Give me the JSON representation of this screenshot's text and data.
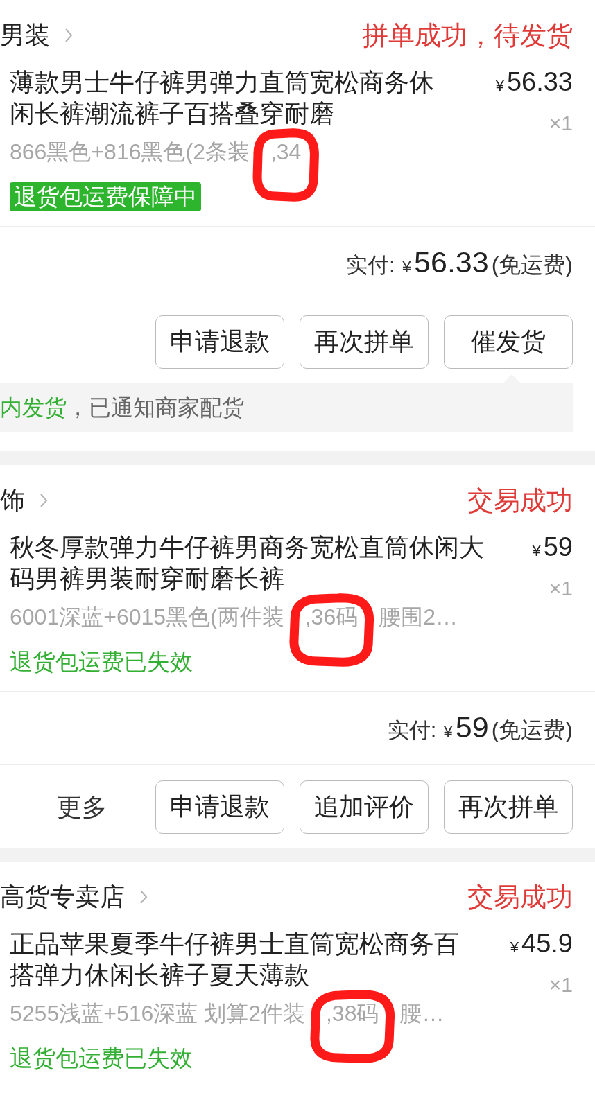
{
  "orders": [
    {
      "shop": "男装",
      "status": "拼单成功，待发货",
      "product": {
        "title": "薄款男士牛仔裤男弹力直筒宽松商务休闲长裤潮流裤子百搭叠穿耐磨",
        "spec": [
          {
            "text": "866黑色+816黑色(2条装",
            "circled": false
          },
          {
            "text": ",34",
            "circled": true
          }
        ],
        "currency": "¥",
        "price": "56.33",
        "quantity": "×1"
      },
      "guarantee": {
        "text": "退货包运费保障中",
        "active": true
      },
      "payment": {
        "label": "实付:",
        "currency": "¥",
        "amount": "56.33",
        "note": "(免运费)"
      },
      "actions": [
        {
          "label": "申请退款",
          "kind": "button"
        },
        {
          "label": "再次拼单",
          "kind": "button"
        },
        {
          "label": "催发货",
          "kind": "button"
        }
      ],
      "tip": {
        "highlight": "内发货",
        "text": "，已通知商家配货"
      }
    },
    {
      "shop": "饰",
      "status": "交易成功",
      "product": {
        "title": "秋冬厚款弹力牛仔裤男商务宽松直筒休闲大码男裤男装耐穿耐磨长裤",
        "spec": [
          {
            "text": "6001深蓝+6015黑色(两件装",
            "circled": false
          },
          {
            "text": ",36码",
            "circled": true
          },
          {
            "text": "腰围2…",
            "circled": false
          }
        ],
        "currency": "¥",
        "price": "59",
        "quantity": "×1"
      },
      "guarantee": {
        "text": "退货包运费已失效",
        "active": false
      },
      "payment": {
        "label": "实付:",
        "currency": "¥",
        "amount": "59",
        "note": "(免运费)"
      },
      "actions": [
        {
          "label": "更多",
          "kind": "link"
        },
        {
          "label": "申请退款",
          "kind": "button"
        },
        {
          "label": "追加评价",
          "kind": "button"
        },
        {
          "label": "再次拼单",
          "kind": "button"
        }
      ]
    },
    {
      "shop": "高货专卖店",
      "status": "交易成功",
      "product": {
        "title": "正品苹果夏季牛仔裤男士直筒宽松商务百搭弹力休闲长裤子夏天薄款",
        "spec": [
          {
            "text": "5255浅蓝+516深蓝 划算2件装",
            "circled": false
          },
          {
            "text": ",38码",
            "circled": true
          },
          {
            "text": "腰…",
            "circled": false
          }
        ],
        "currency": "¥",
        "price": "45.9",
        "quantity": "×1"
      },
      "guarantee": {
        "text": "退货包运费已失效",
        "active": false
      }
    }
  ]
}
